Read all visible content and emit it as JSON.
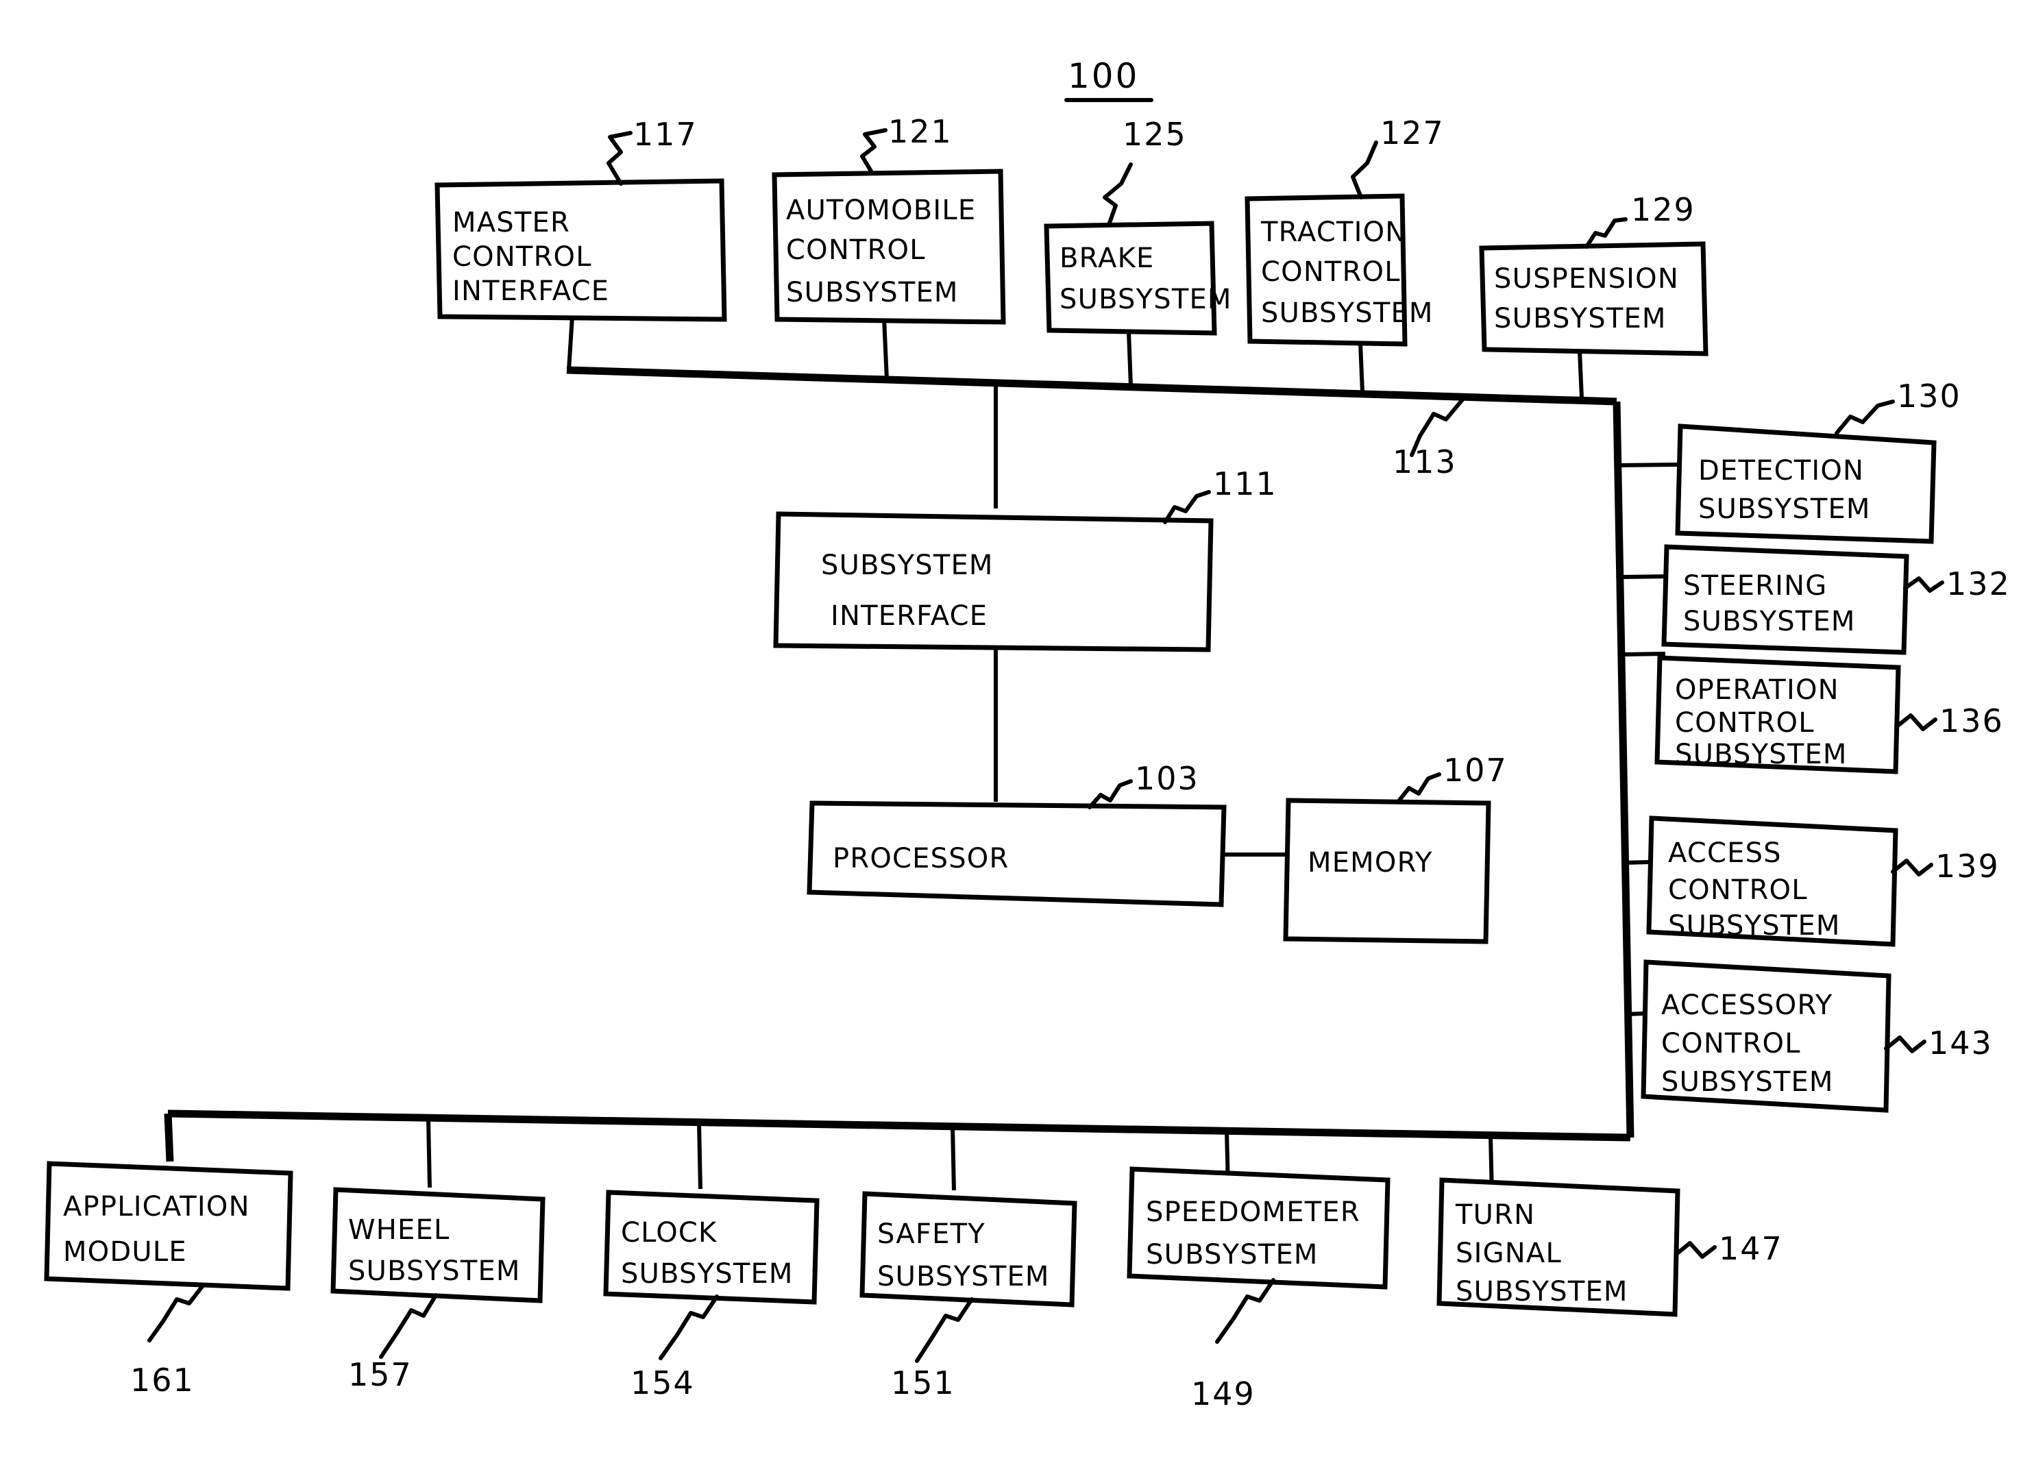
{
  "figure": {
    "number": "100",
    "kind": "patent-block-diagram",
    "ink_color": "#000000",
    "paper_color": "#ffffff"
  },
  "blocks": {
    "master_control_interface": {
      "label_lines": [
        "MASTER",
        "CONTROL",
        "INTERFACE"
      ],
      "ref": "117"
    },
    "automobile_control_subsystem": {
      "label_lines": [
        "AUTOMOBILE",
        "CONTROL",
        "SUBSYSTEM"
      ],
      "ref": "121"
    },
    "brake_subsystem": {
      "label_lines": [
        "BRAKE",
        "SUBSYSTEM"
      ],
      "ref": "125"
    },
    "traction_control_subsystem": {
      "label_lines": [
        "TRACTION",
        "CONTROL",
        "SUBSYSTEM"
      ],
      "ref": "127"
    },
    "suspension_subsystem": {
      "label_lines": [
        "SUSPENSION",
        "SUBSYSTEM"
      ],
      "ref": "129"
    },
    "detection_subsystem": {
      "label_lines": [
        "DETECTION",
        "SUBSYSTEM"
      ],
      "ref": "130"
    },
    "steering_subsystem": {
      "label_lines": [
        "STEERING",
        "SUBSYSTEM"
      ],
      "ref": "132"
    },
    "operation_control_subsystem": {
      "label_lines": [
        "OPERATION",
        "CONTROL",
        "SUBSYSTEM"
      ],
      "ref": "136"
    },
    "access_control_subsystem": {
      "label_lines": [
        "ACCESS",
        "CONTROL",
        "SUBSYSTEM"
      ],
      "ref": "139"
    },
    "accessory_control_subsystem": {
      "label_lines": [
        "ACCESSORY",
        "CONTROL",
        "SUBSYSTEM"
      ],
      "ref": "143"
    },
    "subsystem_interface": {
      "label_lines": [
        "SUBSYSTEM",
        "INTERFACE"
      ],
      "ref": "111"
    },
    "processor": {
      "label_lines": [
        "PROCESSOR"
      ],
      "ref": "103"
    },
    "memory": {
      "label_lines": [
        "MEMORY"
      ],
      "ref": "107"
    },
    "application_module": {
      "label_lines": [
        "APPLICATION",
        "MODULE"
      ],
      "ref": "161"
    },
    "wheel_subsystem": {
      "label_lines": [
        "WHEEL",
        "SUBSYSTEM"
      ],
      "ref": "157"
    },
    "clock_subsystem": {
      "label_lines": [
        "CLOCK",
        "SUBSYSTEM"
      ],
      "ref": "154"
    },
    "safety_subsystem": {
      "label_lines": [
        "SAFETY",
        "SUBSYSTEM"
      ],
      "ref": "151"
    },
    "speedometer_subsystem": {
      "label_lines": [
        "SPEEDOMETER",
        "SUBSYSTEM"
      ],
      "ref": "149"
    },
    "turn_signal_subsystem": {
      "label_lines": [
        "TURN",
        "SIGNAL",
        "SUBSYSTEM"
      ],
      "ref": "147"
    }
  },
  "bus": {
    "ref": "113"
  }
}
